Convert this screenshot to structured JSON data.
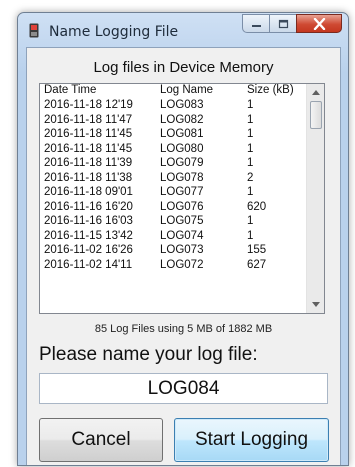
{
  "window": {
    "title": "Name Logging File"
  },
  "log_list": {
    "title": "Log files in Device Memory",
    "columns": [
      "Date Time",
      "Log Name",
      "Size (kB)"
    ],
    "rows": [
      [
        "2016-11-18 12'19",
        "LOG083",
        "1"
      ],
      [
        "2016-11-18 11'47",
        "LOG082",
        "1"
      ],
      [
        "2016-11-18 11'45",
        "LOG081",
        "1"
      ],
      [
        "2016-11-18 11'45",
        "LOG080",
        "1"
      ],
      [
        "2016-11-18 11'39",
        "LOG079",
        "1"
      ],
      [
        "2016-11-18 11'38",
        "LOG078",
        "2"
      ],
      [
        "2016-11-18 09'01",
        "LOG077",
        "1"
      ],
      [
        "2016-11-16 16'20",
        "LOG076",
        "620"
      ],
      [
        "2016-11-16 16'03",
        "LOG075",
        "1"
      ],
      [
        "2016-11-15 13'42",
        "LOG074",
        "1"
      ],
      [
        "2016-11-02 16'26",
        "LOG073",
        "155"
      ],
      [
        "2016-11-02 14'11",
        "LOG072",
        "627"
      ]
    ],
    "summary": "85 Log Files using 5 MB of 1882 MB"
  },
  "form": {
    "prompt": "Please name your log file:",
    "file_name_value": "LOG084"
  },
  "buttons": {
    "cancel": "Cancel",
    "start": "Start Logging"
  },
  "icons": {
    "app": "app-icon",
    "minimize": "minimize-icon",
    "maximize": "maximize-icon",
    "close": "close-icon",
    "scroll_up": "scroll-up-arrow-icon",
    "scroll_down": "scroll-down-arrow-icon"
  },
  "colors": {
    "titlebar": "#b9d1ec",
    "close_button": "#c4361f",
    "default_button_border": "#3c7fb1"
  }
}
